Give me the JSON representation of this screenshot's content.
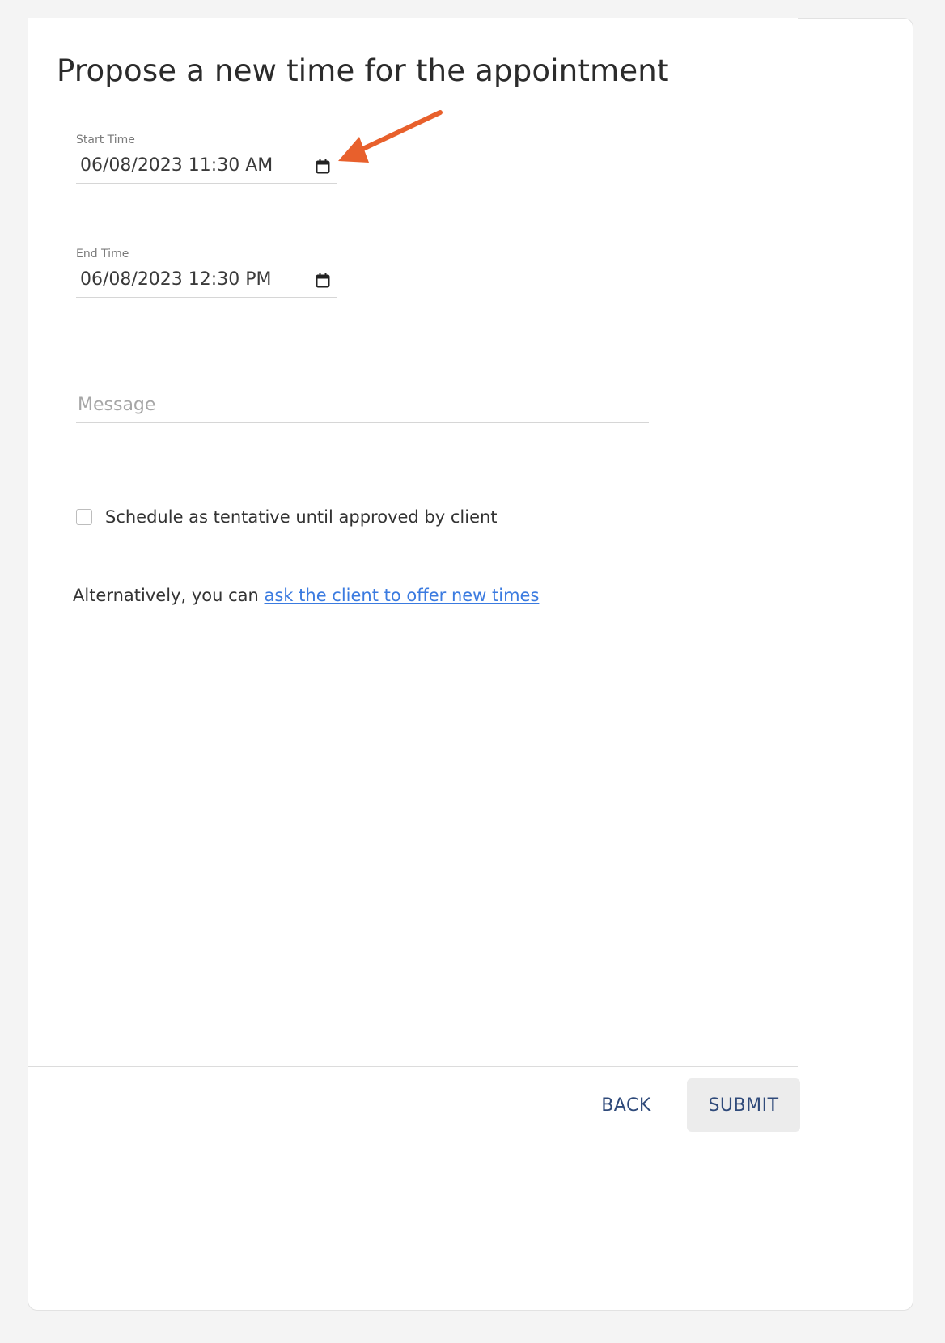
{
  "dialog": {
    "title": "Propose a new time for the appointment"
  },
  "start_time": {
    "label": "Start Time",
    "value": "06/08/2023 11:30 AM",
    "icon": "calendar-icon"
  },
  "end_time": {
    "label": "End Time",
    "value": "06/08/2023 12:30 PM",
    "icon": "calendar-icon"
  },
  "message": {
    "placeholder": "Message",
    "value": ""
  },
  "tentative": {
    "label": "Schedule as tentative until approved by client",
    "checked": false
  },
  "alternative": {
    "prefix": "Alternatively, you can ",
    "link_text": "ask the client to offer new times"
  },
  "footer": {
    "back_label": "BACK",
    "submit_label": "SUBMIT"
  },
  "annotation": {
    "arrow_color": "#e8602c",
    "icon": "arrow-icon"
  },
  "colors": {
    "link": "#3b7be0",
    "button_text": "#2f4a7a",
    "submit_bg": "#ececec"
  }
}
